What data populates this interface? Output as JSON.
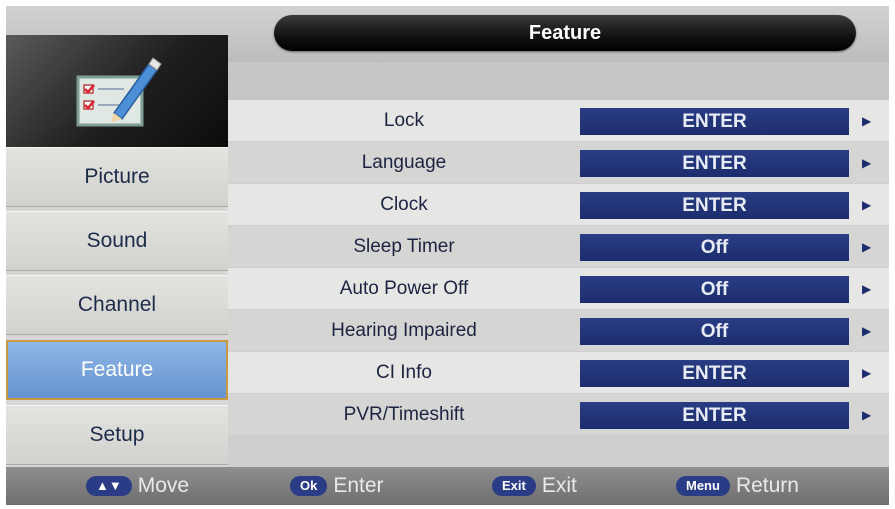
{
  "header": {
    "title": "Feature"
  },
  "sidebar": {
    "icon": "feature-checklist-icon",
    "items": [
      {
        "label": "Picture",
        "active": false
      },
      {
        "label": "Sound",
        "active": false
      },
      {
        "label": "Channel",
        "active": false
      },
      {
        "label": "Feature",
        "active": true
      },
      {
        "label": "Setup",
        "active": false
      }
    ]
  },
  "settings": [
    {
      "label": "Lock",
      "value": "ENTER"
    },
    {
      "label": "Language",
      "value": "ENTER"
    },
    {
      "label": "Clock",
      "value": "ENTER"
    },
    {
      "label": "Sleep Timer",
      "value": "Off"
    },
    {
      "label": "Auto Power Off",
      "value": "Off"
    },
    {
      "label": "Hearing Impaired",
      "value": "Off"
    },
    {
      "label": "CI Info",
      "value": "ENTER"
    },
    {
      "label": "PVR/Timeshift",
      "value": "ENTER"
    }
  ],
  "footer": {
    "hints": [
      {
        "key": "▲▼",
        "label": "Move"
      },
      {
        "key": "Ok",
        "label": "Enter"
      },
      {
        "key": "Exit",
        "label": "Exit"
      },
      {
        "key": "Menu",
        "label": "Return"
      }
    ]
  },
  "colors": {
    "value_bg": "#1f3175",
    "active_item": "#7aa6dc",
    "active_border": "#c79a44",
    "text": "#1c2441"
  }
}
